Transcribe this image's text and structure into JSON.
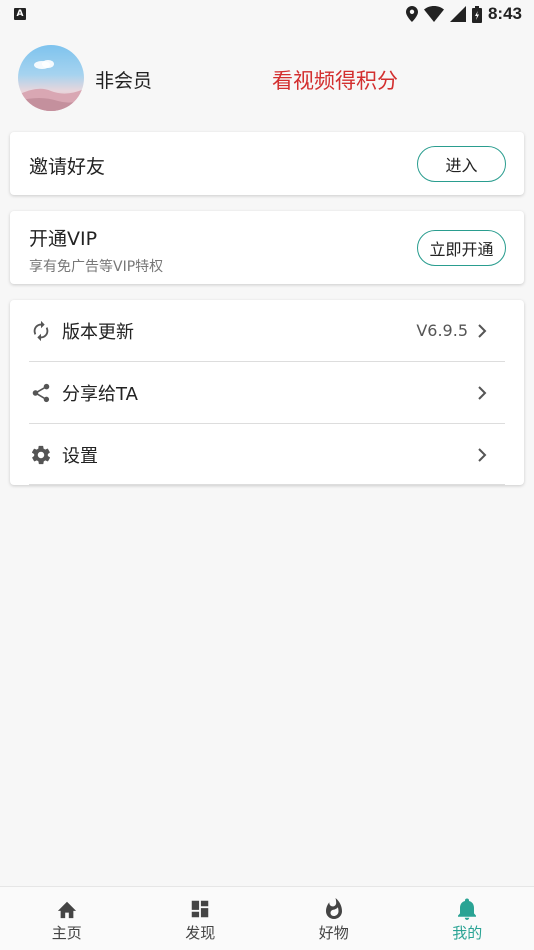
{
  "status_bar": {
    "notification_icon": "A",
    "time": "8:43",
    "icons": [
      "location-icon",
      "wifi-icon",
      "signal-icon",
      "battery-icon"
    ]
  },
  "profile": {
    "avatar": "avatar-image",
    "status": "非会员",
    "reward_link": "看视频得积分",
    "reward_color": "#d32f2f"
  },
  "invite_card": {
    "title": "邀请好友",
    "button": "进入"
  },
  "vip_card": {
    "title": "开通VIP",
    "subtitle": "享有免广告等VIP特权",
    "button": "立即开通"
  },
  "menu": {
    "items": [
      {
        "icon": "refresh-icon",
        "label": "版本更新",
        "value": "V6.9.5"
      },
      {
        "icon": "share-icon",
        "label": "分享给TA",
        "value": ""
      },
      {
        "icon": "gear-icon",
        "label": "设置",
        "value": ""
      }
    ]
  },
  "bottom_nav": {
    "accent": "#2aa394",
    "items": [
      {
        "icon": "home-icon",
        "label": "主页"
      },
      {
        "icon": "dashboard-icon",
        "label": "发现"
      },
      {
        "icon": "flame-icon",
        "label": "好物"
      },
      {
        "icon": "bell-icon",
        "label": "我的",
        "active": true
      }
    ]
  }
}
